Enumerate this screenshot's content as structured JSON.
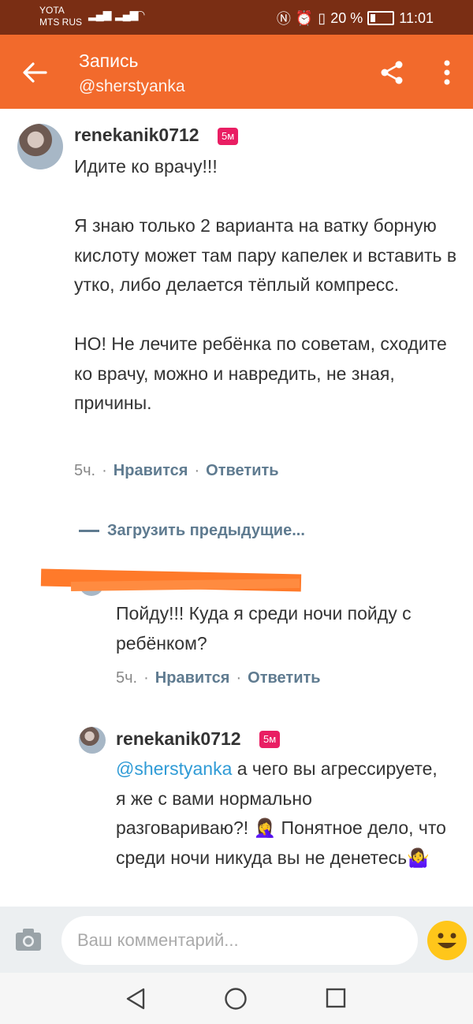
{
  "status_bar": {
    "carrier_1": "YOTA",
    "carrier_2": "MTS RUS",
    "battery": "20 %",
    "time": "11:01"
  },
  "app_bar": {
    "title": "Запись",
    "subtitle": "@sherstyanka",
    "accent_color": "#f26a2c",
    "icons": [
      "arrow-back-icon",
      "share-icon",
      "more-vert-icon"
    ]
  },
  "comments": [
    {
      "username": "renekanik0712",
      "badge": "5м",
      "text": "Идите ко врачу!!!\n\nЯ знаю только 2 варианта на ватку борную кислоту может там пару капелек и вставить в утко, либо делается тёплый компресс.\n\nНО! Не лечите ребёнка по советам, сходите ко врачу, можно и навредить, не зная, причины.",
      "time": "5ч.",
      "like": "Нравится",
      "reply": "Ответить"
    }
  ],
  "load_previous": "Загрузить предыдущие...",
  "replies": [
    {
      "username": "",
      "text": "Пойду!!! Куда я среди ночи пойду с ребёнком?",
      "time": "5ч.",
      "like": "Нравится",
      "reply": "Ответить",
      "redacted": true
    },
    {
      "username": "renekanik0712",
      "badge": "5м",
      "mention": "@sherstyanka",
      "text": " а чего вы агрессируете, я же с вами нормально разговариваю?! 🤦‍♀️ Понятное дело, что среди ночи никуда вы не денетесь🤷‍♀️"
    }
  ],
  "input": {
    "placeholder": "Ваш комментарий..."
  },
  "nav": {
    "icons": [
      "nav-back-icon",
      "nav-home-icon",
      "nav-recents-icon"
    ]
  }
}
